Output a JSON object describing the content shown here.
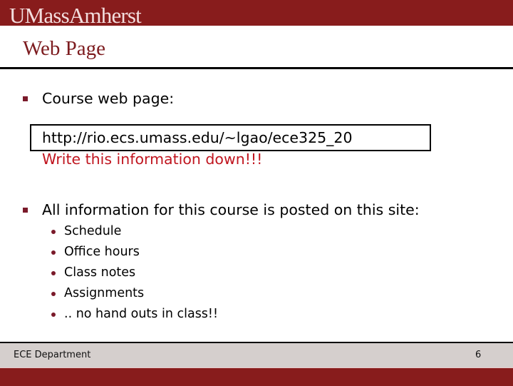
{
  "header": {
    "logo_text": "UMassAmherst",
    "brand_color": "#881c1c"
  },
  "slide": {
    "title": "Web Page",
    "bullets": [
      {
        "text": "Course web page:",
        "url": "http://rio.ecs.umass.edu/~lgao/ece325_20",
        "note": "Write this information down!!!"
      },
      {
        "text": "All information for this course is posted on this site:",
        "sub_items": [
          "Schedule",
          "Office hours",
          "Class notes",
          "Assignments",
          ".. no hand outs in class!!"
        ]
      }
    ]
  },
  "footer": {
    "department": "ECE Department",
    "page_number": "6"
  },
  "colors": {
    "title": "#7d1c1f",
    "note": "#c0151f",
    "bullet": "#7a1a2a",
    "footer_band": "#d5cfcd"
  }
}
